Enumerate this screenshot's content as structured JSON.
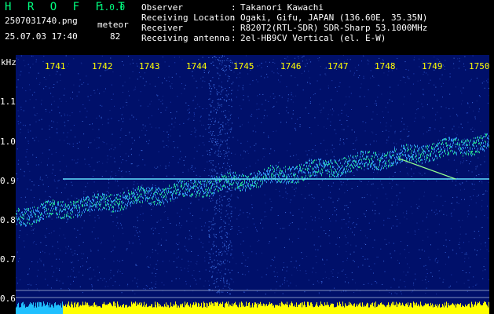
{
  "header": {
    "app_title": "H R O F F T",
    "app_version": "1.0.0",
    "file_name": "2507031740.png",
    "timestamp": "25.07.03 17:40",
    "detection_label": "meteor",
    "detection_count": "82"
  },
  "info": [
    {
      "key": "Observer",
      "value": "Takanori Kawachi"
    },
    {
      "key": "Receiving Location",
      "value": "Ogaki, Gifu, JAPAN (136.60E, 35.35N)"
    },
    {
      "key": "Receiver",
      "value": "R820T2(RTL-SDR) SDR-Sharp 53.1000MHz"
    },
    {
      "key": "Receiving antenna",
      "value": "2el-HB9CV Vertical (el. E-W)"
    }
  ],
  "axes": {
    "y_unit": "kHz",
    "y_ticks": [
      "1.1",
      "1.0",
      "0.9",
      "0.8",
      "0.7",
      "0.6"
    ],
    "x_ticks": [
      "1741",
      "1742",
      "1743",
      "1744",
      "1745",
      "1746",
      "1747",
      "1748",
      "1749",
      "1750"
    ]
  },
  "colors": {
    "background": "#00106a",
    "title_green": "#00ff80",
    "tick_yellow": "#ffff00",
    "carrier_line": "#60e0ff"
  }
}
